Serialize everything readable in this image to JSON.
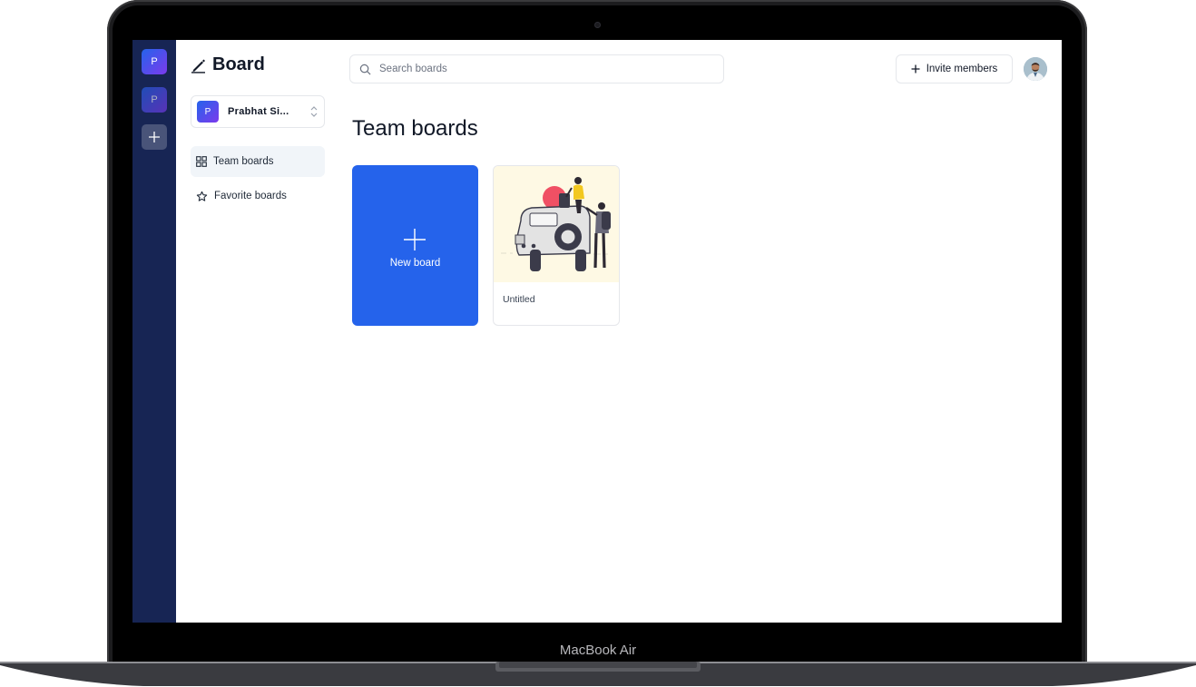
{
  "device": {
    "label": "MacBook Air"
  },
  "rail": {
    "orgs": [
      {
        "initial": "P"
      },
      {
        "initial": "P"
      }
    ],
    "add_icon": "plus-icon"
  },
  "sidebar": {
    "brand": "Board",
    "brand_icon": "pencil-icon",
    "workspace": {
      "initial": "P",
      "name": "Prabhat Si..."
    },
    "nav": [
      {
        "label": "Team boards",
        "icon": "grid-icon",
        "active": true
      },
      {
        "label": "Favorite boards",
        "icon": "star-icon",
        "active": false
      }
    ]
  },
  "header": {
    "search_placeholder": "Search boards",
    "invite_label": "Invite members"
  },
  "main": {
    "title": "Team boards",
    "new_board_label": "New board",
    "boards": [
      {
        "title": "Untitled"
      }
    ]
  },
  "colors": {
    "rail": "#172554",
    "accent": "#2563eb",
    "thumb_bg": "#fef9e4"
  }
}
